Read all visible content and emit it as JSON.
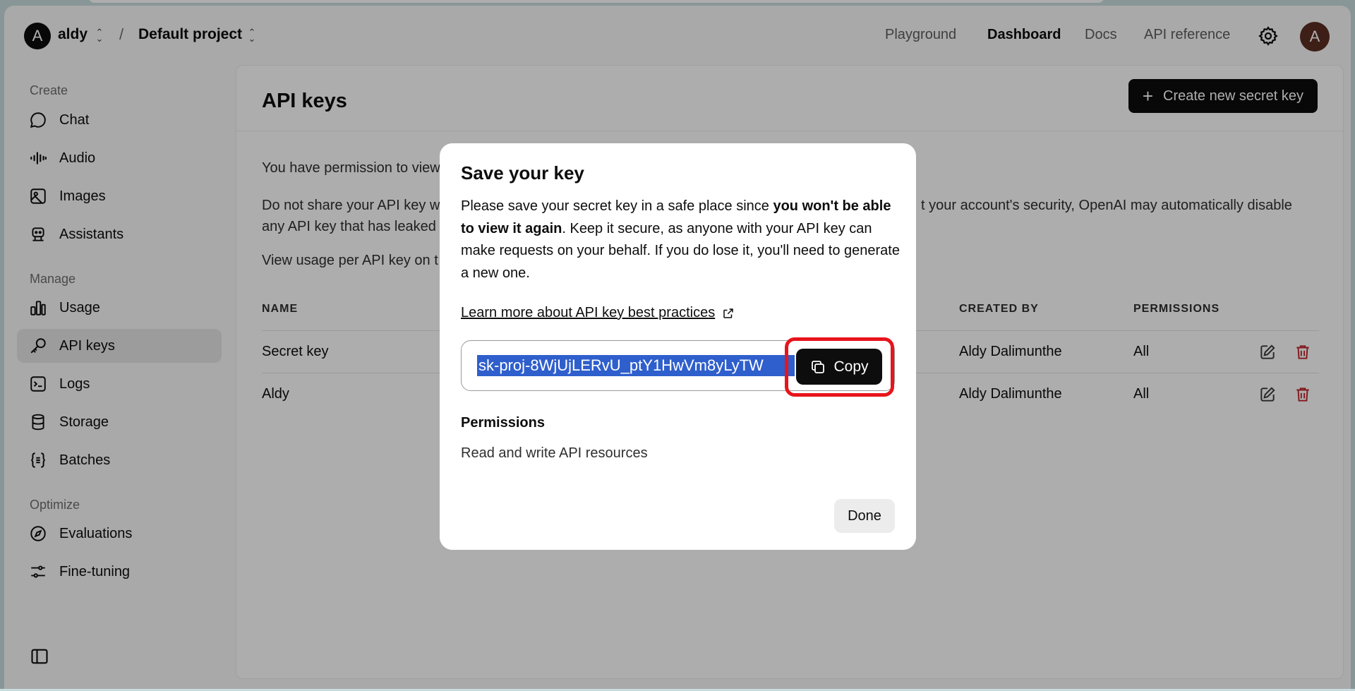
{
  "header": {
    "org_initial": "A",
    "org_name": "aldy",
    "separator": "/",
    "project_name": "Default project",
    "nav": [
      {
        "label": "Playground",
        "active": false
      },
      {
        "label": "Dashboard",
        "active": true
      },
      {
        "label": "Docs",
        "active": false
      },
      {
        "label": "API reference",
        "active": false
      }
    ],
    "settings_icon": "gear-icon",
    "user_initial": "A"
  },
  "sidebar": {
    "sections": [
      {
        "label": "Create",
        "items": [
          {
            "label": "Chat",
            "icon": "chat-bubble-icon"
          },
          {
            "label": "Audio",
            "icon": "audio-wave-icon"
          },
          {
            "label": "Images",
            "icon": "image-icon"
          },
          {
            "label": "Assistants",
            "icon": "robot-icon"
          }
        ]
      },
      {
        "label": "Manage",
        "items": [
          {
            "label": "Usage",
            "icon": "bar-chart-icon"
          },
          {
            "label": "API keys",
            "icon": "key-icon",
            "active": true
          },
          {
            "label": "Logs",
            "icon": "terminal-icon"
          },
          {
            "label": "Storage",
            "icon": "database-icon"
          },
          {
            "label": "Batches",
            "icon": "braces-icon"
          }
        ]
      },
      {
        "label": "Optimize",
        "items": [
          {
            "label": "Evaluations",
            "icon": "compass-icon"
          },
          {
            "label": "Fine-tuning",
            "icon": "sliders-icon"
          }
        ]
      }
    ],
    "collapse_icon": "sidebar-toggle-icon"
  },
  "main": {
    "title": "API keys",
    "create_button": "Create new secret key",
    "para1": "You have permission to view",
    "para2_line1_left": "Do not share your API key w",
    "para2_line1_right": "t your account's security, OpenAI may automatically disable",
    "para2_line2": "any API key that has leaked",
    "para3": "View usage per API key on t",
    "table": {
      "headers": {
        "name": "NAME",
        "created_by": "CREATED BY",
        "permissions": "PERMISSIONS"
      },
      "rows": [
        {
          "name": "Secret key",
          "created_by": "Aldy Dalimunthe",
          "permissions": "All"
        },
        {
          "name": "Aldy",
          "created_by": "Aldy Dalimunthe",
          "permissions": "All"
        }
      ]
    }
  },
  "modal": {
    "title": "Save your key",
    "body_pre": "Please save your secret key in a safe place since ",
    "body_bold": "you won't be able to view it again",
    "body_post": ". Keep it secure, as anyone with your API key can make requests on your behalf. If you do lose it, you'll need to generate a new one.",
    "learn_more": "Learn more about API key best practices",
    "key_value": "sk-proj-8WjUjLERvU_ptY1HwVm8yLyTW",
    "copy_label": "Copy",
    "permissions_label": "Permissions",
    "permissions_value": "Read and write API resources",
    "done_label": "Done"
  },
  "colors": {
    "accent_dark": "#0d0d0d",
    "highlight_red": "#e8141b",
    "selection_blue": "#2f5fcc",
    "delete_red": "#c0262d"
  }
}
